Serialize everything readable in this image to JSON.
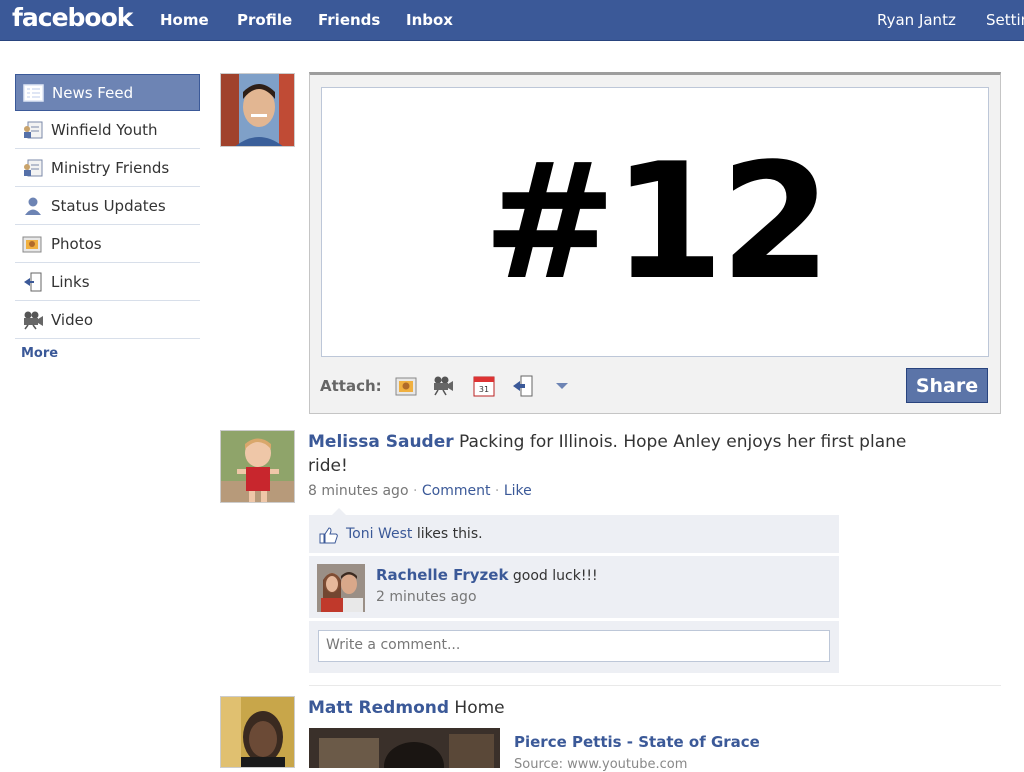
{
  "header": {
    "logo": "facebook",
    "nav": [
      "Home",
      "Profile",
      "Friends",
      "Inbox"
    ],
    "user_name": "Ryan Jantz",
    "settings_label": "Settin"
  },
  "sidebar": {
    "items": [
      {
        "label": "News Feed",
        "icon": "news-feed-icon"
      },
      {
        "label": "Winfield Youth",
        "icon": "friend-list-icon"
      },
      {
        "label": "Ministry Friends",
        "icon": "friend-list-icon"
      },
      {
        "label": "Status Updates",
        "icon": "status-icon"
      },
      {
        "label": "Photos",
        "icon": "photos-icon"
      },
      {
        "label": "Links",
        "icon": "links-icon"
      },
      {
        "label": "Video",
        "icon": "video-icon"
      }
    ],
    "more_label": "More"
  },
  "composer": {
    "text": "#12",
    "attach_label": "Attach:",
    "attach_icons": [
      "photos-icon",
      "video-icon",
      "event-icon",
      "links-icon",
      "dropdown-arrow-icon"
    ],
    "share_label": "Share"
  },
  "stories": [
    {
      "author": "Melissa Sauder",
      "message_line1": "Packing for Illinois. Hope Anley enjoys her first plane",
      "message_line2": "ride!",
      "time": "8 minutes ago",
      "sep": "·",
      "comment_label": "Comment",
      "like_label": "Like",
      "likes": {
        "name": "Toni West",
        "suffix": "likes this."
      },
      "comments": [
        {
          "author": "Rachelle Fryzek",
          "text": "good luck!!!",
          "time": "2 minutes ago"
        }
      ],
      "comment_placeholder": "Write a comment..."
    },
    {
      "author": "Matt Redmond",
      "message": "Home",
      "attachment_title": "Pierce Pettis - State of Grace",
      "attachment_source": "Source: www.youtube.com"
    }
  ],
  "colors": {
    "brand": "#3b5998",
    "sidebar_active": "#6d84b4",
    "share_button": "#5b74a8",
    "ufi_background": "#edeff4"
  }
}
